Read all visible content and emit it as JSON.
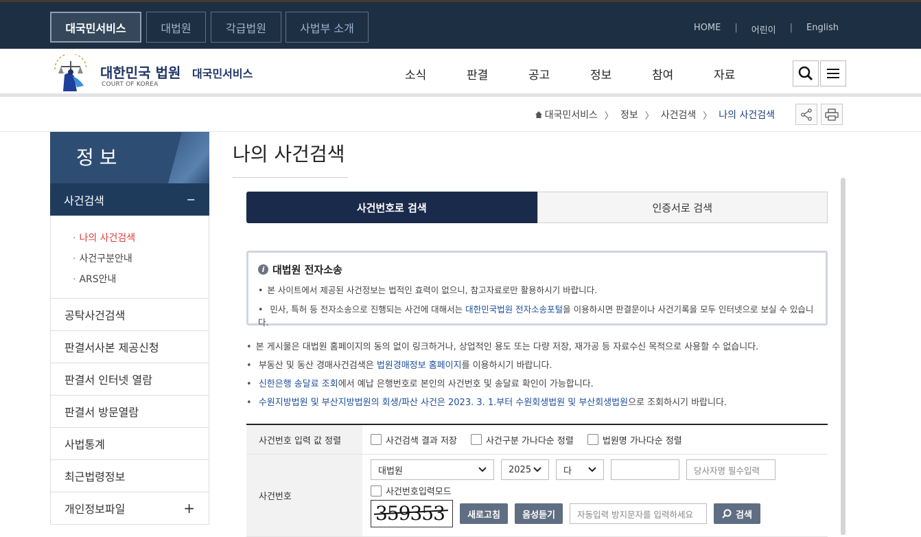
{
  "topbar": {
    "tabs": [
      "대국민서비스",
      "대법원",
      "각급법원",
      "사법부 소개"
    ],
    "links": [
      "HOME",
      "어린이",
      "English"
    ]
  },
  "header": {
    "logo_title": "대한민국 법원",
    "logo_sub": "COURT OF KOREA",
    "service": "대국민서비스",
    "menu": [
      "소식",
      "판결",
      "공고",
      "정보",
      "참여",
      "자료"
    ]
  },
  "breadcrumb": [
    "대국민서비스",
    "정보",
    "사건검색",
    "나의 사건검색"
  ],
  "sidebar": {
    "title": "정보",
    "selected": "사건검색",
    "selected_toggle": "−",
    "sub_items": [
      "나의 사건검색",
      "사건구분안내",
      "ARS안내"
    ],
    "items": [
      "공탁사건검색",
      "판결서사본 제공신청",
      "판결서 인터넷 열람",
      "판결서 방문열람",
      "사법통계",
      "최근법령정보",
      "개인정보파일"
    ],
    "last_toggle": "+"
  },
  "page": {
    "title": "나의 사건검색",
    "tabs": [
      "사건번호로 검색",
      "인증서로 검색"
    ]
  },
  "notice": {
    "title": "대법원 전자소송",
    "line1": "본 사이트에서 제공된 사건정보는 법적인 효력이 없으니, 참고자료로만 활용하시기 바랍니다.",
    "line2_pre": "민사, 특허 등 전자소송으로 진행되는 사건에 대해서는 ",
    "line2_link": "대한민국법원 전자소송포털",
    "line2_post": "을 이용하시면 판결문이나 사건기록을 모두 인터넷으로 보실 수 있습니다."
  },
  "bullets": {
    "b1": "본 게시물은 대법원 홈페이지의 동의 없이 링크하거나, 상업적인 용도 또는 다량 저장, 재가공 등 자료수신 목적으로 사용할 수 없습니다.",
    "b2_pre": "부동산 및 동산 경매사건검색은 ",
    "b2_link": "법원경매정보 홈페이지",
    "b2_post": "를 이용하시기 바랍니다.",
    "b3_link": "신한은행 송달료 조회",
    "b3_post": "에서 예납 은행번호로 본인의 사건번호 및 송달료 확인이 가능합니다.",
    "b4_link": "수원지방법원 및 부산지방법원의 회생/파산 사건은 2023. 3. 1.부터 수원회생법원 및 부산회생법원",
    "b4_post": "으로 조회하시기 바랍니다."
  },
  "form": {
    "sort_label": "사건번호 입력 값 정렬",
    "checks": [
      "사건검색 결과 저장",
      "사건구분 가나다순 정렬",
      "법원명 가나다순 정렬"
    ],
    "case_label": "사건번호",
    "court": "대법원",
    "year": "2025",
    "case_type": "다",
    "case_number_value": "",
    "party_placeholder": "당사자명 필수입력",
    "input_mode": "사건번호입력모드",
    "captcha_text": "359353",
    "refresh": "새로고침",
    "audio": "음성듣기",
    "captcha_placeholder": "자동입력 방지문자를 입력하세요",
    "search": "검색"
  }
}
